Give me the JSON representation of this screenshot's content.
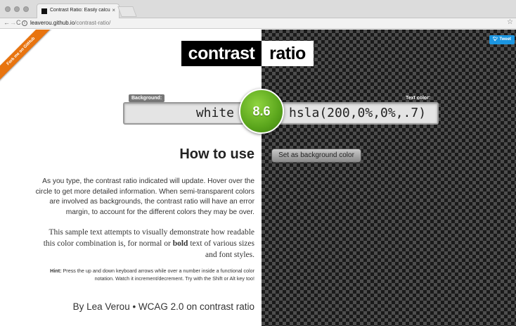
{
  "browser": {
    "tab_title": "Contrast Ratio: Easily calculate",
    "tab_close": "×",
    "url_host": "leaverou.github.io",
    "url_path": "/contrast-ratio/",
    "back_glyph": "←",
    "forward_glyph": "→",
    "reload_glyph": "C",
    "info_glyph": "i",
    "star_glyph": "☆"
  },
  "ribbon": {
    "label": "Fork me on GitHub"
  },
  "tweet": {
    "label": "Tweet"
  },
  "title": {
    "left": "contrast",
    "right": "ratio"
  },
  "inputs": {
    "background_label": "Background:",
    "background_value": "white",
    "text_color_label": "Text color:",
    "text_color_value": "hsla(200,0%,0%,.7)"
  },
  "ratio": {
    "value": "8.6"
  },
  "swap_button": {
    "label": "Set as background color"
  },
  "how_to_use": {
    "heading": "How to use",
    "para1": "As you type, the contrast ratio indicated will update. Hover over the circle to get more detailed information. When semi-transparent colors are involved as backgrounds, the contrast ratio will have an error margin, to account for the different colors they may be over.",
    "para2_before": "This sample text attempts to visually demonstrate how readable this color combination is, for normal or ",
    "para2_bold": "bold",
    "para2_after": " text of various sizes and font styles.",
    "hint_label": "Hint:",
    "hint_text": " Press the up and down keyboard arrows while over a number inside a functional color notation. Watch it increment/decrement. Try with the Shift or Alt key too!",
    "credits": "By Lea Verou • WCAG 2.0 on contrast ratio"
  },
  "colors": {
    "ratio_circle": "#5aa51c",
    "ribbon": "#e8740f",
    "tweet": "#1b95e0",
    "checker_dark": "#1a1a1a",
    "checker_light": "#4d4d4d"
  },
  "icons": {
    "traffic_lights": [
      "close-dot",
      "minimize-dot",
      "zoom-dot"
    ],
    "star": "star-icon",
    "info": "info-icon",
    "tweet": "twitter-bird-icon"
  }
}
